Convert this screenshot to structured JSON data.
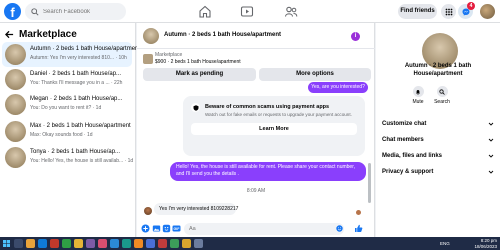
{
  "topbar": {
    "logo": "f",
    "search_placeholder": "Search Facebook",
    "find_friends": "Find friends",
    "notification_count": "4",
    "icons": [
      "home-icon",
      "video-icon",
      "friends-icon",
      "menu-grid-icon",
      "messenger-icon",
      "bell-icon"
    ]
  },
  "sidebar": {
    "title": "Marketplace",
    "conversations": [
      {
        "title": "Autumn · 2 beds 1 bath House/apartment",
        "preview": "Autumn: Yes I'm very interested 810... · 10h",
        "active": true
      },
      {
        "title": "Daniel · 2 beds 1 bath House/ap...",
        "preview": "You: Thanks I'll message you in a ... · 22h",
        "active": false
      },
      {
        "title": "Megan · 2 beds 1 bath House/ap...",
        "preview": "You: Do you want to rent it? · 1d",
        "active": false
      },
      {
        "title": "Max · 2 beds 1 bath House/apartment",
        "preview": "Max: Okay sounds food · 1d",
        "active": false
      },
      {
        "title": "Tonya · 2 beds 1 bath House/ap...",
        "preview": "You: Hello! Yes, the house is still availab... · 1d",
        "active": false
      }
    ]
  },
  "chat": {
    "title": "Autumn · 2 beds 1 bath House/apartment",
    "listing_label": "Marketplace",
    "listing_price": "$900 · 2 beds 1 bath House/apartment",
    "mark_pending": "Mark as pending",
    "more_options": "More options",
    "msg_out_1": "Yes, are you interested?",
    "scam_title": "Beware of common scams using payment apps",
    "scam_desc": "Watch out for fake emails or requests to upgrade your payment account.",
    "learn_more": "Learn More",
    "msg_out_2": "Hello! Yes, the house is still available for rent. Please share your contact number, and I'll send you the details .",
    "timestamp": "8:09 AM",
    "msg_in": "Yes I'm very interested 8109228217",
    "composer_placeholder": "Aa"
  },
  "right_panel": {
    "title_line1": "Autumn · 2 beds 1 bath",
    "title_line2": "House/apartment",
    "mute": "Mute",
    "search": "Search",
    "rows": [
      "Customize chat",
      "Chat members",
      "Media, files and links",
      "Privacy & support"
    ]
  },
  "taskbar": {
    "time": "8:20 pm",
    "date": "18/06/2023",
    "tray": "ENG"
  },
  "colors": {
    "accent": "#1877f2",
    "bubble_out": "#8a3ffc",
    "taskbar": "#1f2b46"
  }
}
